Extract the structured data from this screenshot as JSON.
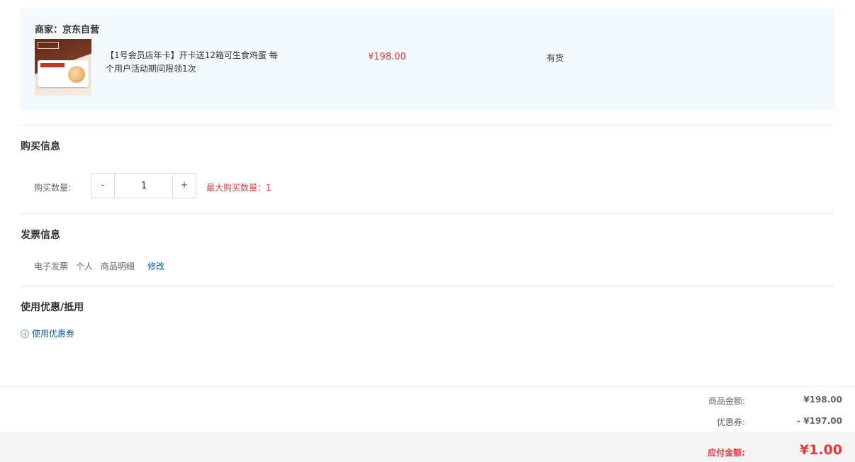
{
  "merchant": {
    "label": "商家：京东自营",
    "product": {
      "image": "product-thumbnail",
      "name": "【1号会员店年卡】开卡送12箱可生食鸡蛋 每个用户活动期间限领1次",
      "price": "¥198.00",
      "stock": "有货"
    }
  },
  "purchase": {
    "title": "购买信息",
    "qty_label": "购买数量:",
    "minus_label": "-",
    "plus_label": "+",
    "quantity": "1",
    "max_text": "最大购买数量：1"
  },
  "invoice": {
    "title": "发票信息",
    "type": "电子发票",
    "person": "个人",
    "content": "商品明细",
    "edit_label": "修改"
  },
  "coupon": {
    "title": "使用优惠/抵用",
    "link_label": "使用优惠券",
    "icon": "plus-circle-icon"
  },
  "summary": {
    "goods_label": "商品金额:",
    "goods_value": "¥198.00",
    "coupon_label": "优惠券:",
    "coupon_value": "- ¥197.00",
    "pay_label": "应付金额:",
    "pay_value": "¥1.00"
  },
  "colors": {
    "accent_red": "#e4393c",
    "link_blue": "#005ea7",
    "merchant_bg": "#f3f9fd"
  }
}
